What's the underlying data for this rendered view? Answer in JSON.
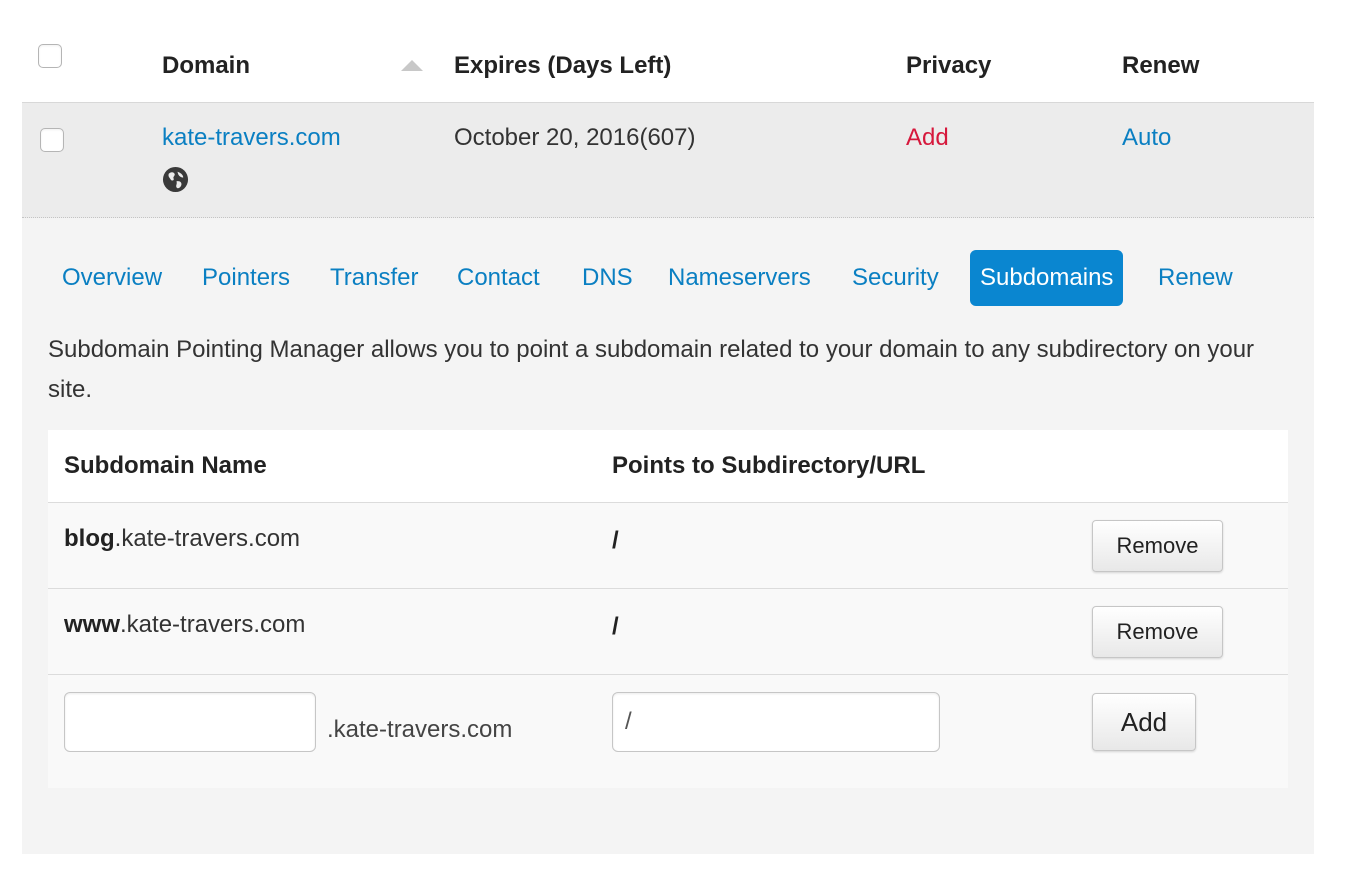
{
  "table_header": {
    "domain": "Domain",
    "expires": "Expires (Days Left)",
    "privacy": "Privacy",
    "renew": "Renew"
  },
  "domain_row": {
    "domain": "kate-travers.com",
    "expires": "October 20, 2016(607)",
    "privacy": "Add",
    "renew": "Auto",
    "icon": "globe-icon"
  },
  "tabs": [
    {
      "label": "Overview",
      "active": false
    },
    {
      "label": "Pointers",
      "active": false
    },
    {
      "label": "Transfer",
      "active": false
    },
    {
      "label": "Contact",
      "active": false
    },
    {
      "label": "DNS",
      "active": false
    },
    {
      "label": "Nameservers",
      "active": false
    },
    {
      "label": "Security",
      "active": false
    },
    {
      "label": "Subdomains",
      "active": true
    },
    {
      "label": "Renew",
      "active": false
    }
  ],
  "description": "Subdomain Pointing Manager allows you to point a subdomain related to your domain to any subdirectory on your site.",
  "subdomains": {
    "headers": {
      "name": "Subdomain Name",
      "points_to": "Points to Subdirectory/URL"
    },
    "rows": [
      {
        "sub": "blog",
        "domain": ".kate-travers.com",
        "path": "/",
        "action": "Remove"
      },
      {
        "sub": "www",
        "domain": ".kate-travers.com",
        "path": "/",
        "action": "Remove"
      }
    ],
    "new": {
      "name_value": "",
      "suffix": ".kate-travers.com",
      "path_value": "/",
      "action": "Add"
    }
  },
  "colors": {
    "link": "#0a7fc2",
    "privacy_add": "#d6183c",
    "active_tab": "#0a86d0",
    "row_background": "#ececec",
    "panel_background": "#f4f4f4"
  }
}
